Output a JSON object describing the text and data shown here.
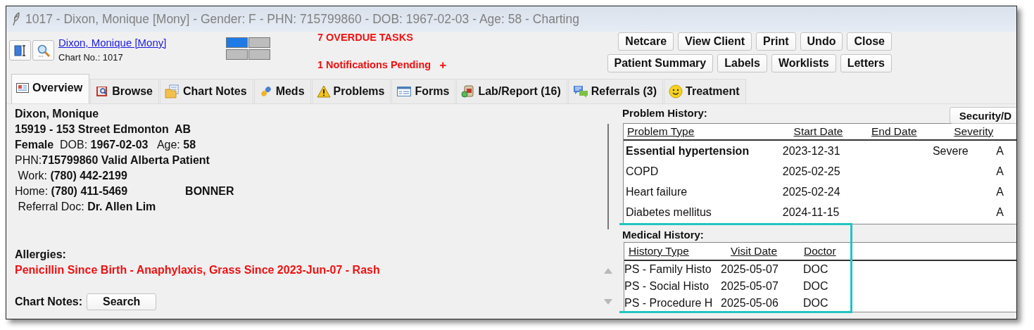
{
  "window": {
    "title": "1017 - Dixon, Monique [Mony] - Gender: F - PHN: 715799860 - DOB: 1967-02-03 - Age: 58 - Charting"
  },
  "header": {
    "patient_link": "Dixon, Monique [Mony]",
    "chart_no": "Chart No.: 1017",
    "overdue_tasks": "7 OVERDUE TASKS",
    "notifications": "1 Notifications Pending",
    "notifications_add": "+"
  },
  "buttons_row_1": [
    "Netcare",
    "View Client",
    "Print",
    "Undo",
    "Close"
  ],
  "buttons_row_2": [
    "Patient Summary",
    "Labels",
    "Worklists",
    "Letters"
  ],
  "tabs": [
    {
      "label": "Overview",
      "selected": true
    },
    {
      "label": "Browse",
      "selected": false
    },
    {
      "label": "Chart Notes",
      "selected": false
    },
    {
      "label": "Meds",
      "selected": false
    },
    {
      "label": "Problems",
      "selected": false
    },
    {
      "label": "Forms",
      "selected": false
    },
    {
      "label": "Lab/Report (16)",
      "selected": false
    },
    {
      "label": "Referrals (3)",
      "selected": false
    },
    {
      "label": "Treatment",
      "selected": false
    }
  ],
  "overview": {
    "demographics": [
      {
        "text": "**Dixon, Monique**"
      },
      {
        "text": "**15919 - 153 Street Edmonton  AB**"
      },
      {
        "text": "**Female**  DOB: **1967-02-03**   Age: **58**"
      },
      {
        "text": "PHN:**715799860 Valid Alberta Patient**"
      },
      {
        "text": " Work: **(780) 442-2199**"
      },
      {
        "text": "Home: **(780) 411-5469**",
        "extra": "BONNER"
      },
      {
        "text": " Referral Doc: **Dr. Allen Lim**"
      }
    ],
    "allergies": {
      "heading": "Allergies:",
      "text": "Penicillin Since Birth - Anaphylaxis, Grass Since 2023-Jun-07 - Rash"
    },
    "chart_notes": {
      "heading": "Chart Notes:",
      "search_button": "Search"
    }
  },
  "problem_history": {
    "title": "Problem History:",
    "security_button": "Security/D",
    "columns": [
      "Problem Type",
      "Start Date",
      "End Date",
      "Severity"
    ],
    "rows": [
      {
        "problem_type": "Essential hypertension",
        "start_date": "2023-12-31",
        "severity": "Severe",
        "column_5": "A",
        "bold": true
      },
      {
        "problem_type": "COPD",
        "start_date": "2025-02-25",
        "column_5": "A",
        "bold": false
      },
      {
        "problem_type": "Heart failure",
        "start_date": "2025-02-24",
        "column_5": "A",
        "bold": false
      },
      {
        "problem_type": "Diabetes mellitus",
        "start_date": "2024-11-15",
        "column_5": "A",
        "bold": false
      }
    ]
  },
  "medical_history": {
    "title": "Medical History:",
    "highlighted": true,
    "columns": [
      "History Type",
      "Visit Date",
      "Doctor"
    ],
    "rows": [
      {
        "history_type": "PS - Family Histo",
        "visit_date": "2025-05-07",
        "doctor": "DOC"
      },
      {
        "history_type": "PS - Social Histo",
        "visit_date": "2025-05-07",
        "doctor": "DOC"
      },
      {
        "history_type": "PS - Procedure H",
        "visit_date": "2025-05-06",
        "doctor": "DOC"
      }
    ]
  }
}
